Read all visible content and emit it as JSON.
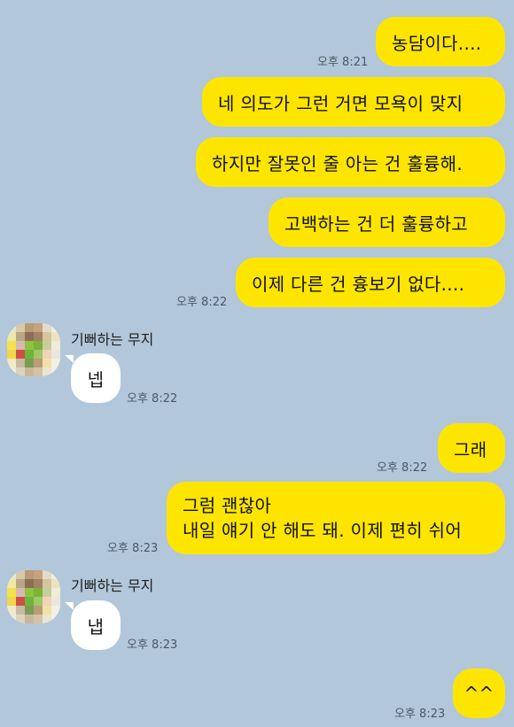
{
  "contact": {
    "name": "기뻐하는 무지"
  },
  "messages": [
    {
      "from": "me",
      "text": "농담이다....",
      "time": "오후 8:21"
    },
    {
      "from": "me",
      "text": "네 의도가 그런 거면 모욕이 맞지"
    },
    {
      "from": "me",
      "text": "하지만 잘못인 줄 아는 건 훌륭해."
    },
    {
      "from": "me",
      "text": "고백하는 건 더 훌륭하고"
    },
    {
      "from": "me",
      "text": "이제 다른 건 흉보기 없다....",
      "time": "오후 8:22"
    },
    {
      "from": "them",
      "text": "넵",
      "time": "오후 8:22"
    },
    {
      "from": "me",
      "text": "그래",
      "time": "오후 8:22"
    },
    {
      "from": "me",
      "lines": [
        "그럼 괜찮아",
        "내일 얘기 안 해도 돼. 이제 편히 쉬어"
      ],
      "time": "오후 8:23"
    },
    {
      "from": "them",
      "text": "냅",
      "time": "오후 8:23"
    },
    {
      "from": "me",
      "text": "^^",
      "time": "오후 8:23"
    }
  ],
  "colors": {
    "background": "#b2c7da",
    "outgoing_bubble": "#fee500",
    "incoming_bubble": "#ffffff"
  }
}
